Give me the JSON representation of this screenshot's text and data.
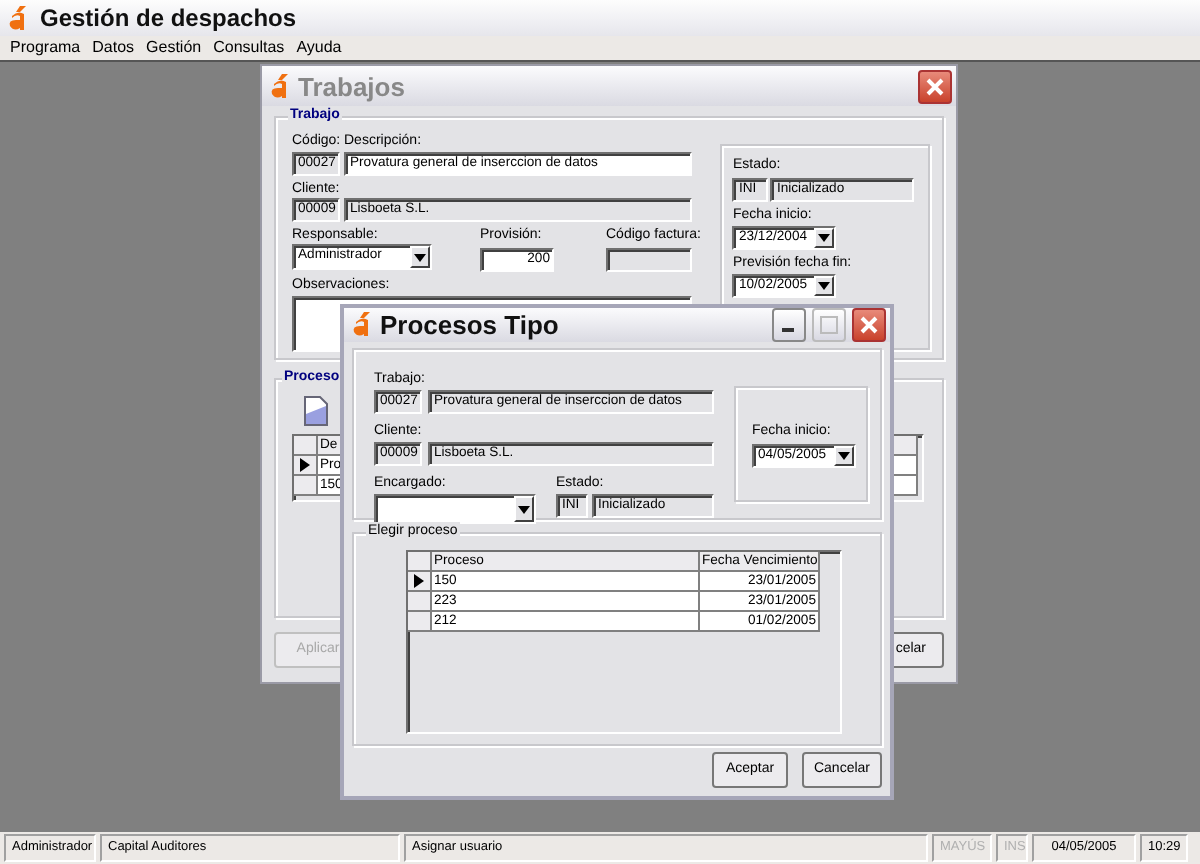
{
  "app": {
    "title": "Gestión de despachos"
  },
  "menu": [
    "Programa",
    "Datos",
    "Gestión",
    "Consultas",
    "Ayuda"
  ],
  "trabajos_window": {
    "title": "Trabajos",
    "active": false,
    "trabajo_group": {
      "title": "Trabajo",
      "codigo_label": "Código:",
      "descripcion_label": "Descripción:",
      "codigo": "00027",
      "descripcion": "Provatura general de inserccion de datos",
      "cliente_label": "Cliente:",
      "cliente_codigo": "00009",
      "cliente": "Lisboeta S.L.",
      "responsable_label": "Responsable:",
      "responsable": "Administrador",
      "provision_label": "Provisión:",
      "provision": "200",
      "codigo_factura_label": "Código factura:",
      "observaciones_label": "Observaciones:",
      "estado_label": "Estado:",
      "estado_codigo": "INI",
      "estado": "Inicializado",
      "fecha_inicio_label": "Fecha inicio:",
      "fecha_inicio": "23/12/2004",
      "prevision_label": "Previsión fecha fin:",
      "prevision": "10/02/2005"
    },
    "proceso_group": {
      "title": "Proceso",
      "column_1": "De",
      "rows": [
        {
          "cell": "Pro",
          "selected": true
        },
        {
          "cell": "150",
          "selected": false
        }
      ]
    },
    "buttons": [
      {
        "label": "Aplicar",
        "disabled": true
      },
      {
        "label": "celar",
        "disabled": false
      }
    ]
  },
  "procesos_window": {
    "title": "Procesos Tipo",
    "active": true,
    "trabajo_label": "Trabajo:",
    "trabajo_codigo": "00027",
    "trabajo": "Provatura general de inserccion de datos",
    "cliente_label": "Cliente:",
    "cliente_codigo": "00009",
    "cliente": "Lisboeta S.L.",
    "encargado_label": "Encargado:",
    "estado_label": "Estado:",
    "estado_codigo": "INI",
    "estado": "Inicializado",
    "fecha_inicio_label": "Fecha inicio:",
    "fecha_inicio": "04/05/2005",
    "elegir_group": {
      "title": "Elegir proceso",
      "columns": [
        "Proceso",
        "Fecha Vencimiento"
      ],
      "rows": [
        {
          "proceso": "150",
          "fecha": "23/01/2005",
          "selected": true
        },
        {
          "proceso": "223",
          "fecha": "23/01/2005",
          "selected": false
        },
        {
          "proceso": "212",
          "fecha": "01/02/2005",
          "selected": false
        }
      ]
    },
    "buttons": [
      {
        "label": "Aceptar",
        "disabled": false
      },
      {
        "label": "Cancelar",
        "disabled": false
      }
    ]
  },
  "status_bar": [
    {
      "text": "Administrador",
      "disabled": false
    },
    {
      "text": "Capital Auditores",
      "disabled": false
    },
    {
      "text": "Asignar usuario",
      "disabled": false
    },
    {
      "text": "MAYÚS",
      "disabled": true
    },
    {
      "text": "INS",
      "disabled": true
    },
    {
      "text": "04/05/2005",
      "disabled": false
    },
    {
      "text": "10:29",
      "disabled": false
    }
  ]
}
